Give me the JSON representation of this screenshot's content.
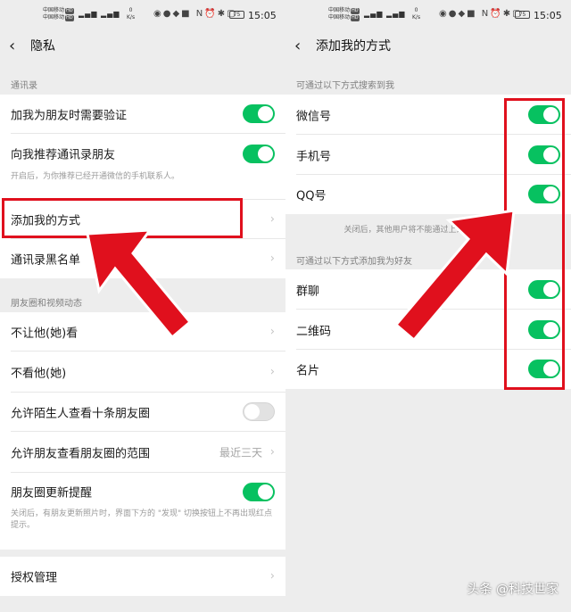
{
  "status_bar": {
    "carrier_1": "中国移动",
    "carrier_2": "中国移动",
    "hd_badge": "HD",
    "net_speed_value": "0",
    "net_speed_unit": "K/s",
    "battery": "75",
    "time": "15:05"
  },
  "left_screen": {
    "nav_title": "隐私",
    "section_contacts": "通讯录",
    "row_verify": "加我为朋友时需要验证",
    "row_recommend": "向我推荐通讯录朋友",
    "row_recommend_desc": "开启后，为你推荐已经开通微信的手机联系人。",
    "row_add_methods": "添加我的方式",
    "row_blacklist": "通讯录黑名单",
    "section_moments": "朋友圈和视频动态",
    "row_hide_from": "不让他(她)看",
    "row_dont_see": "不看他(她)",
    "row_stranger_ten": "允许陌生人查看十条朋友圈",
    "row_range": "允许朋友查看朋友圈的范围",
    "row_range_value": "最近三天",
    "row_update_reminder": "朋友圈更新提醒",
    "row_update_desc": "关闭后，有朋友更新照片时，界面下方的 \"发现\" 切换按钮上不再出现红点提示。",
    "row_authorization": "授权管理",
    "toggles": {
      "verify": true,
      "recommend": true,
      "stranger_ten": false,
      "update_reminder": true
    }
  },
  "right_screen": {
    "nav_title": "添加我的方式",
    "section_search": "可通过以下方式搜索到我",
    "row_wechat_id": "微信号",
    "row_phone": "手机号",
    "row_qq": "QQ号",
    "notice": "关闭后，其他用户将不能通过上述信息找到你。",
    "section_add_friend": "可通过以下方式添加我为好友",
    "row_group_chat": "群聊",
    "row_qrcode": "二维码",
    "row_card": "名片",
    "toggles": {
      "wechat_id": true,
      "phone": true,
      "qq": true,
      "group_chat": true,
      "qrcode": true,
      "card": true
    }
  },
  "watermark": "头条 @科技世家",
  "colors": {
    "toggle_on": "#07c160",
    "highlight": "#e0101d",
    "background": "#ededed"
  }
}
